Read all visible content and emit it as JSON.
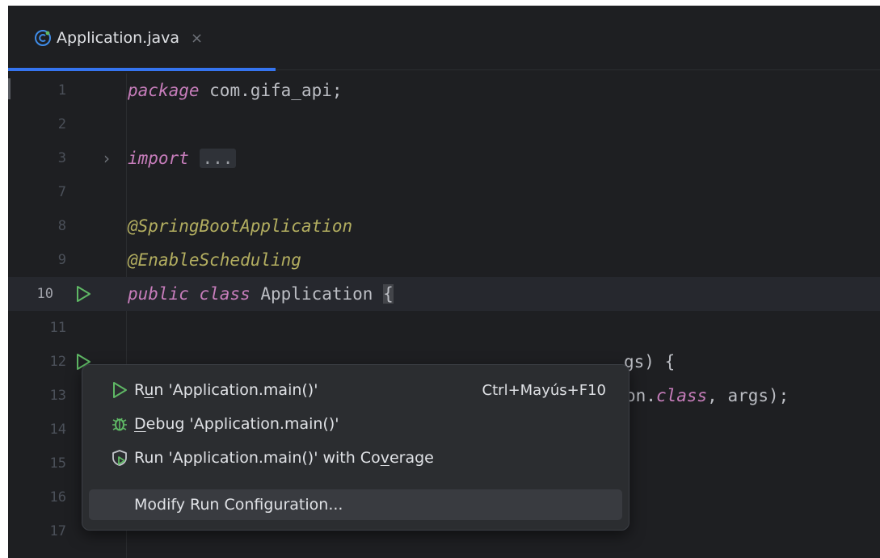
{
  "tab": {
    "title": "Application.java",
    "close": "×"
  },
  "lines": [
    {
      "num": "1",
      "code": "package com.gifa_api;"
    },
    {
      "num": "2",
      "code": ""
    },
    {
      "num": "3",
      "code": "import ..."
    },
    {
      "num": "7",
      "code": ""
    },
    {
      "num": "8",
      "code": "@SpringBootApplication"
    },
    {
      "num": "9",
      "code": "@EnableScheduling"
    },
    {
      "num": "10",
      "code": "public class Application {"
    },
    {
      "num": "11",
      "code": ""
    },
    {
      "num": "12",
      "code": "gs) {"
    },
    {
      "num": "13",
      "code": "on.class, args);"
    },
    {
      "num": "14",
      "code": ""
    },
    {
      "num": "15",
      "code": ""
    },
    {
      "num": "16",
      "code": ""
    },
    {
      "num": "17",
      "code": ""
    }
  ],
  "code_tokens": {
    "package_kw": "package",
    "package_name": " com.gifa_api;",
    "import_kw": "import",
    "import_fold": "...",
    "anno1": "@SpringBootApplication",
    "anno2": "@EnableScheduling",
    "public_kw": "public",
    "class_kw": "class",
    "class_name": " Application ",
    "open_brace": "{",
    "line12_visible": "gs) {",
    "line13_prefix": "on.",
    "line13_class": "class",
    "line13_suffix": ", args);"
  },
  "popup": {
    "items": [
      {
        "icon": "run-icon",
        "label_pre": "R",
        "label_u": "u",
        "label_post": "n 'Application.main()'",
        "shortcut": "Ctrl+Mayús+F10"
      },
      {
        "icon": "debug-icon",
        "label_pre": "",
        "label_u": "D",
        "label_post": "ebug 'Application.main()'",
        "shortcut": ""
      },
      {
        "icon": "coverage-icon",
        "label_pre": "Run 'Application.main()' with Co",
        "label_u": "v",
        "label_post": "erage",
        "shortcut": ""
      },
      {
        "icon": "",
        "label_pre": "Modify Run Configuration...",
        "label_u": "",
        "label_post": "",
        "shortcut": ""
      }
    ],
    "selected_index": 3
  },
  "colors": {
    "background": "#1e1f22",
    "accent": "#3574f0",
    "run_green": "#5fb865",
    "keyword": "#c77dbb",
    "annotation": "#b3ae60"
  }
}
